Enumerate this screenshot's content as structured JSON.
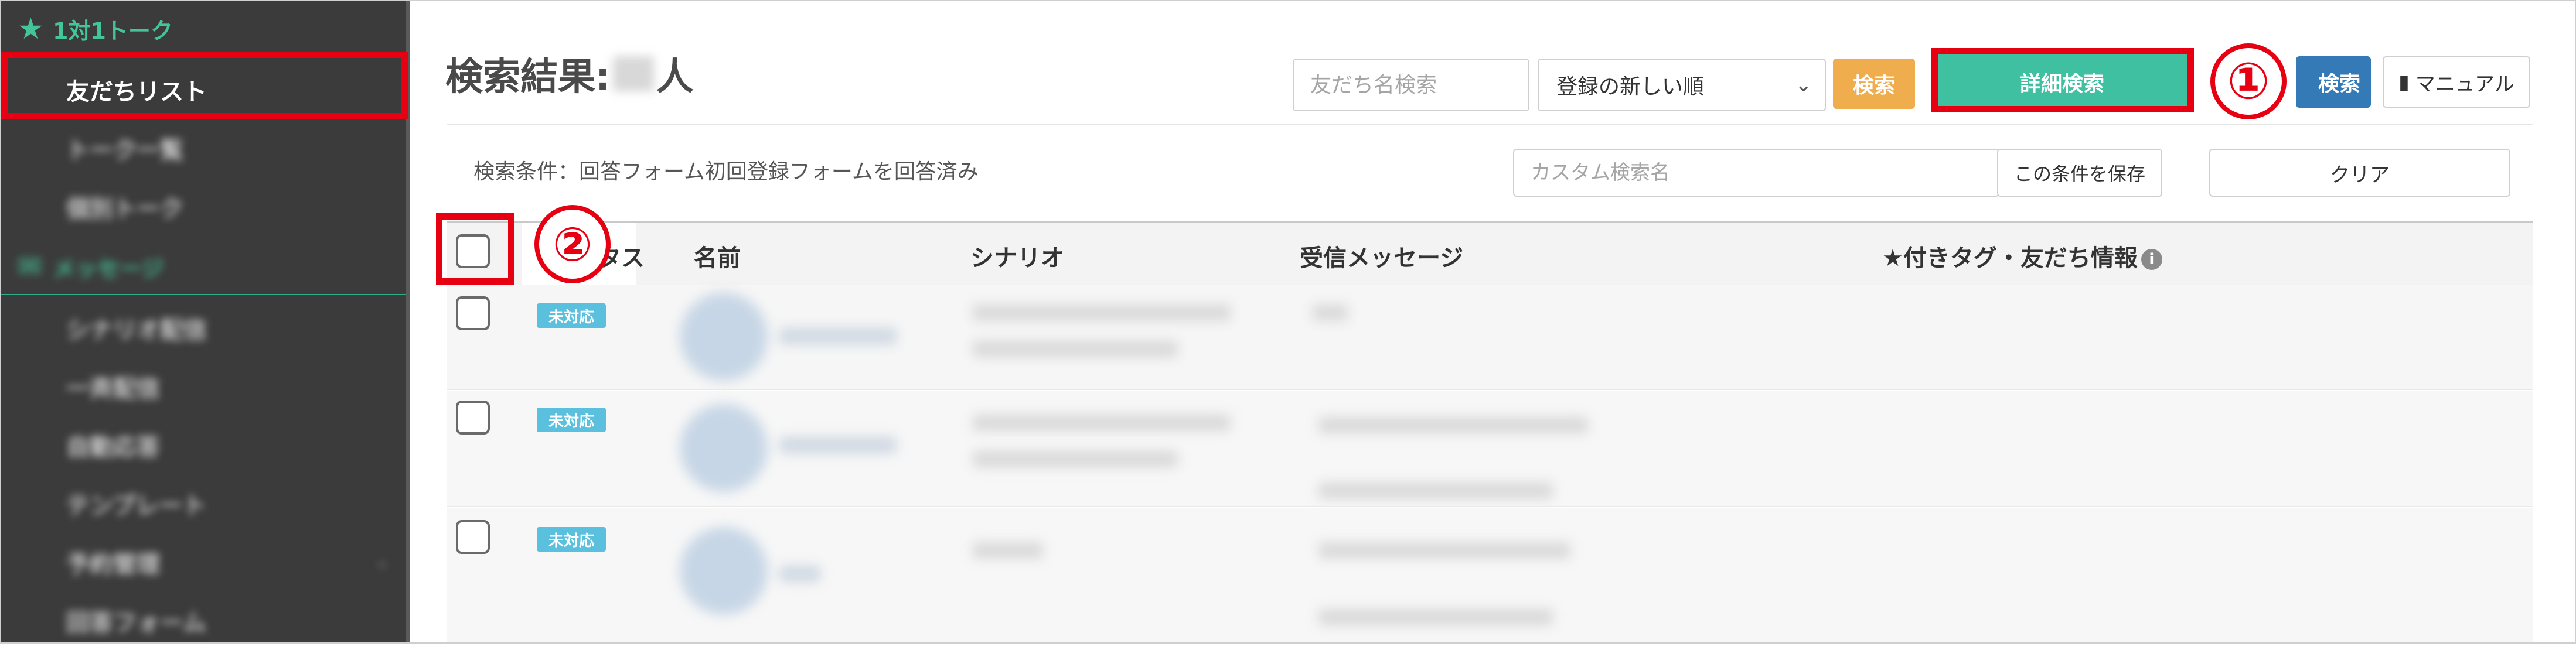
{
  "sidebar": {
    "section_talk": "1対1トーク",
    "friends_list": "友だちリスト",
    "talk_list": "トーク一覧",
    "individual_talk": "個別トーク",
    "section_message": "メッセージ",
    "scenario": "シナリオ配信",
    "broadcast": "一斉配信",
    "auto_reply": "自動応答",
    "template": "テンプレート",
    "scheduled": "予約管理",
    "answer_form": "回答フォーム"
  },
  "header": {
    "title_prefix": "検索結果:",
    "title_suffix": "人",
    "name_search_placeholder": "友だち名検索",
    "sort_selected": "登録の新しい順",
    "search_button": "検索",
    "detail_search_button": "詳細検索",
    "search2_button": "検索",
    "manual_button": "マニュアル"
  },
  "conditions": {
    "text": "検索条件：回答フォーム初回登録フォームを回答済み",
    "custom_name_placeholder": "カスタム検索名",
    "save_button": "この条件を保存",
    "clear_button": "クリア"
  },
  "table": {
    "col_status": "ステータス",
    "col_name": "名前",
    "col_scenario": "シナリオ",
    "col_message": "受信メッセージ",
    "col_tags": "★付きタグ・友だち情報",
    "rows": [
      {
        "status": "未対応"
      },
      {
        "status": "未対応"
      },
      {
        "status": "未対応"
      }
    ]
  },
  "annotations": {
    "one": "①",
    "two": "②"
  },
  "colors": {
    "accent_green": "#3fc0a0",
    "highlight_red": "#e60012",
    "sidebar_bg": "#3b3b3b"
  }
}
